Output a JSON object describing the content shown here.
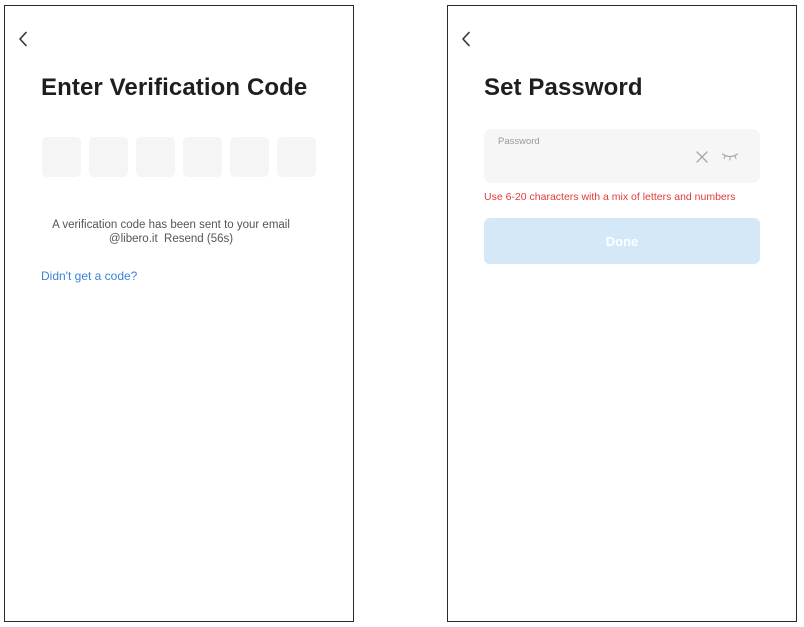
{
  "verification_screen": {
    "title": "Enter Verification Code",
    "code_length": 6,
    "sent_message_line1": "A verification code has been sent to your email",
    "sent_email": "@libero.it",
    "resend_label": "Resend (56s)",
    "didnt_get_code_label": "Didn't get a code?"
  },
  "password_screen": {
    "title": "Set Password",
    "password_label": "Password",
    "password_value": "",
    "hint": "Use 6-20 characters with a mix of letters and numbers",
    "done_label": "Done"
  },
  "colors": {
    "link": "#3a84d6",
    "error": "#e23a3a",
    "button_disabled": "#d4e8f8",
    "field_background": "#f5f5f5"
  },
  "icons": [
    "chevron-left-icon",
    "close-icon",
    "eye-closed-icon"
  ]
}
